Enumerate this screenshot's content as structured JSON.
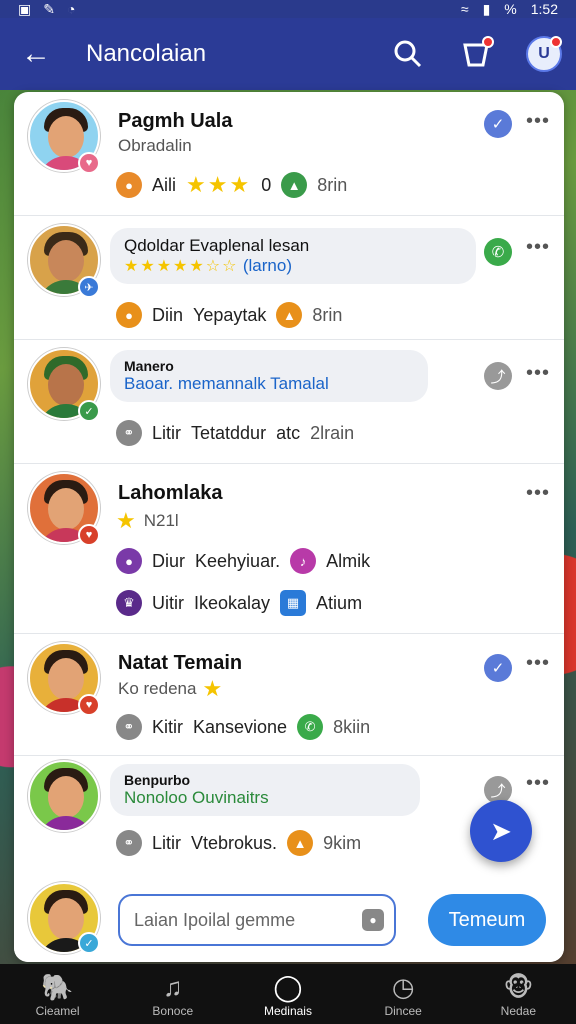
{
  "status": {
    "time": "1:52",
    "battery": "%"
  },
  "appbar": {
    "title": "Nancolaian"
  },
  "contacts": [
    {
      "name": "Pagmh Uala",
      "sub": "Obradalin",
      "meta": [
        "Aili",
        "0",
        "8rin"
      ],
      "stars": 3
    },
    {
      "bubble_title": "Qdoldar Evaplenal lesan",
      "bubble_sub": "(larno)",
      "meta": [
        "Diin",
        "Yepaytak",
        "8rin"
      ]
    },
    {
      "bubble_title": "Manero",
      "bubble_sub": "Baoar. memannalk Tamalal",
      "meta": [
        "Litir",
        "Tetatddur",
        "atc",
        "2lrain"
      ]
    },
    {
      "name": "Lahomlaka",
      "sub": "N21l",
      "meta1": [
        "Diur",
        "Keehyiuar.",
        "Almik"
      ],
      "meta2": [
        "Uitir",
        "Ikeokalay",
        "Atium"
      ]
    },
    {
      "name": "Natat Temain",
      "sub": "Ko redena",
      "meta": [
        "Kitir",
        "Kansevione",
        "8kiin"
      ]
    },
    {
      "bubble_title": "Benpurbo",
      "bubble_sub": "Nonoloo Ouvinaitrs",
      "meta": [
        "Litir",
        "Vtebrokus.",
        "9kim"
      ]
    }
  ],
  "composer": {
    "placeholder": "Laian Ipoilal gemme",
    "send_label": "Temeum"
  },
  "nav": [
    {
      "label": "Cieamel",
      "icon": "elephant-icon"
    },
    {
      "label": "Bonoce",
      "icon": "music-icon"
    },
    {
      "label": "Medinais",
      "icon": "ring-icon"
    },
    {
      "label": "Dincee",
      "icon": "timer-icon"
    },
    {
      "label": "Nedae",
      "icon": "monkey-icon"
    }
  ],
  "colors": {
    "appbar": "#2b3b96",
    "accent": "#2f52d0",
    "star": "#f5c400"
  }
}
